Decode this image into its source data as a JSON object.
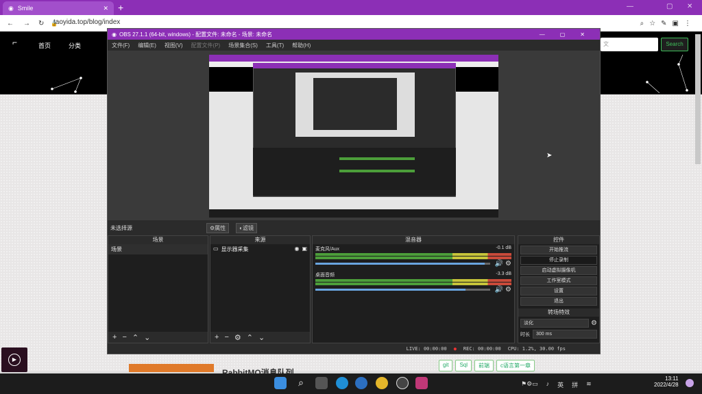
{
  "browser": {
    "tab_title": "Smile",
    "url": "taoyida.top/blog/index"
  },
  "blog": {
    "nav": [
      "首页",
      "分类"
    ],
    "search_placeholder": "文",
    "search_button": "Search",
    "article_title": "RabbitMQ消息队列",
    "tags": [
      "git",
      "Sql",
      "前端",
      "c语言第一章"
    ]
  },
  "obs": {
    "title": "OBS 27.1.1 (64-bit, windows) - 配置文件: 未命名 - 场景: 未命名",
    "menu": [
      "文件(F)",
      "编辑(E)",
      "视图(V)",
      "配置文件(P)",
      "场景集合(S)",
      "工具(T)",
      "帮助(H)"
    ],
    "no_source": "未选择源",
    "properties": "属性",
    "filters": "滤镜",
    "docks": {
      "scenes": "场景",
      "sources": "来源",
      "mixer": "混音器",
      "controls": "控件",
      "transitions": "转场特效"
    },
    "scene_item": "场景",
    "source_item": "显示器采集",
    "mixer": [
      {
        "name": "麦克风/Aux",
        "db": "-0.1 dB",
        "level": 0.97
      },
      {
        "name": "桌面音频",
        "db": "-3.3 dB",
        "level": 0.86
      }
    ],
    "controls": [
      "开始推流",
      "停止录制",
      "启动虚拟摄像机",
      "工作室模式",
      "设置",
      "退出"
    ],
    "transition": "淡化",
    "duration_label": "时长",
    "duration": "300 ms",
    "status": {
      "live": "LIVE: 00:00:00",
      "rec": "REC: 00:00:00",
      "cpu": "CPU: 1.2%, 30.00 fps"
    }
  },
  "taskbar": {
    "time": "13:11",
    "date": "2022/4/28",
    "ime": "英",
    "ime2": "拼"
  }
}
